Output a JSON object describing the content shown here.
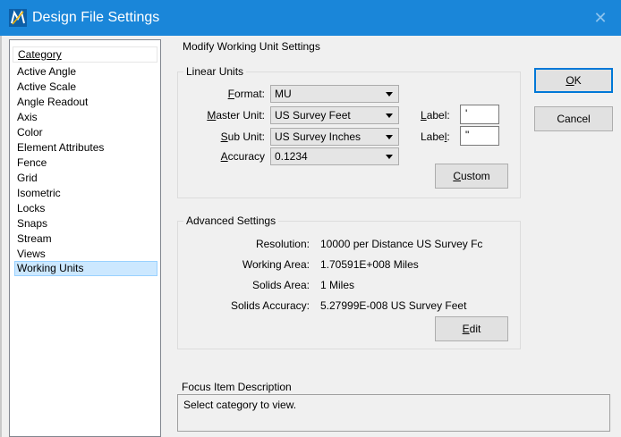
{
  "window": {
    "title": "Design File Settings",
    "close_glyph": "✕",
    "app_icon": "microstation-icon"
  },
  "category_list": {
    "header": "Category",
    "items": [
      "Active Angle",
      "Active Scale",
      "Angle Readout",
      "Axis",
      "Color",
      "Element Attributes",
      "Fence",
      "Grid",
      "Isometric",
      "Locks",
      "Snaps",
      "Stream",
      "Views",
      "Working Units"
    ],
    "selected": "Working Units"
  },
  "panel": {
    "title": "Modify Working Unit Settings",
    "linear_units": {
      "legend": "Linear Units",
      "format_label": "Format:",
      "format_value": "MU",
      "master_unit_label": "Master Unit:",
      "master_unit_value": "US Survey Feet",
      "sub_unit_label": "Sub Unit:",
      "sub_unit_value": "US Survey Inches",
      "accuracy_label": "Accuracy",
      "accuracy_value": "0.1234",
      "master_label_label": "Label:",
      "master_label_value": "'",
      "sub_label_label": "Label:",
      "sub_label_value": "\"",
      "custom_button": "Custom"
    },
    "advanced": {
      "legend": "Advanced Settings",
      "resolution_label": "Resolution:",
      "resolution_value": "10000 per Distance US Survey Fc",
      "working_area_label": "Working Area:",
      "working_area_value": "1.70591E+008 Miles",
      "solids_area_label": "Solids Area:",
      "solids_area_value": "1 Miles",
      "solids_accuracy_label": "Solids Accuracy:",
      "solids_accuracy_value": "5.27999E-008 US Survey Feet",
      "edit_button": "Edit"
    },
    "focus": {
      "label": "Focus Item Description",
      "text": "Select category to view."
    }
  },
  "buttons": {
    "ok": "OK",
    "cancel": "Cancel"
  },
  "colors": {
    "titlebar": "#1a86d9",
    "selection": "#cce8ff",
    "default_button_border": "#0078d7"
  }
}
